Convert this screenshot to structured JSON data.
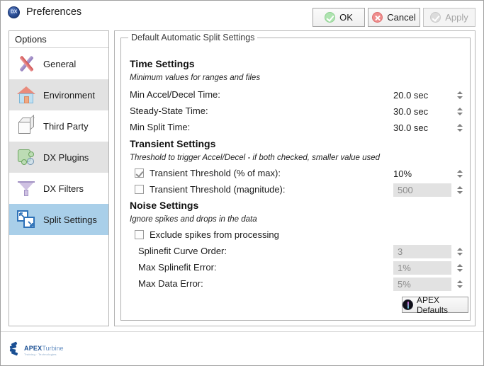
{
  "window": {
    "title": "Preferences",
    "app_icon": "dx-app-icon",
    "help_label": "?",
    "close_label": "✕"
  },
  "sidebar": {
    "header": "Options",
    "items": [
      {
        "label": "General",
        "icon": "tools-icon",
        "selected": false
      },
      {
        "label": "Environment",
        "icon": "house-icon",
        "selected": false
      },
      {
        "label": "Third Party",
        "icon": "cube-icon",
        "selected": false
      },
      {
        "label": "DX Plugins",
        "icon": "puzzle-piece-icon",
        "selected": false
      },
      {
        "label": "DX Filters",
        "icon": "funnel-icon",
        "selected": false
      },
      {
        "label": "Split Settings",
        "icon": "split-arrows-icon",
        "selected": true
      }
    ]
  },
  "groupbox": {
    "title": "Default Automatic Split Settings"
  },
  "sections": {
    "time": {
      "heading": "Time Settings",
      "subtitle": "Minimum values for ranges and files",
      "rows": [
        {
          "label": "Min Accel/Decel Time:",
          "value": "20.0 sec",
          "disabled": false
        },
        {
          "label": "Steady-State Time:",
          "value": "30.0 sec",
          "disabled": false
        },
        {
          "label": "Min Split Time:",
          "value": "30.0 sec",
          "disabled": false
        }
      ]
    },
    "transient": {
      "heading": "Transient Settings",
      "subtitle": "Threshold to trigger Accel/Decel - if both checked, smaller value used",
      "rows": [
        {
          "label": "Transient Threshold (% of max):",
          "value": "10%",
          "checked": true,
          "disabled": false
        },
        {
          "label": "Transient Threshold (magnitude):",
          "value": "500",
          "checked": false,
          "disabled": true
        }
      ]
    },
    "noise": {
      "heading": "Noise Settings",
      "subtitle": "Ignore spikes and drops in the data",
      "checkbox": {
        "label": "Exclude spikes from processing",
        "checked": false
      },
      "rows": [
        {
          "label": "Splinefit Curve Order:",
          "value": "3",
          "disabled": true
        },
        {
          "label": "Max Splinefit Error:",
          "value": "1%",
          "disabled": true
        },
        {
          "label": "Max Data Error:",
          "value": "5%",
          "disabled": true
        }
      ]
    }
  },
  "apex_defaults": {
    "label": "APEX Defaults",
    "icon": "apex-logo-icon"
  },
  "footer": {
    "logo": {
      "name": "APEX",
      "word": "Turbine",
      "tagline": "Training · Technologies"
    },
    "buttons": [
      {
        "label": "OK",
        "icon": "check-circle-icon",
        "state": "enabled"
      },
      {
        "label": "Cancel",
        "icon": "cross-circle-icon",
        "state": "enabled"
      },
      {
        "label": "Apply",
        "icon": "check-circle-icon",
        "state": "disabled"
      }
    ]
  },
  "colors": {
    "selection": "#a9cfe9",
    "alt_row": "#e2e2e2",
    "disabled_field": "#e2e2e2",
    "disabled_text": "#8c8c8c",
    "accent_blue": "#2e72b8"
  }
}
